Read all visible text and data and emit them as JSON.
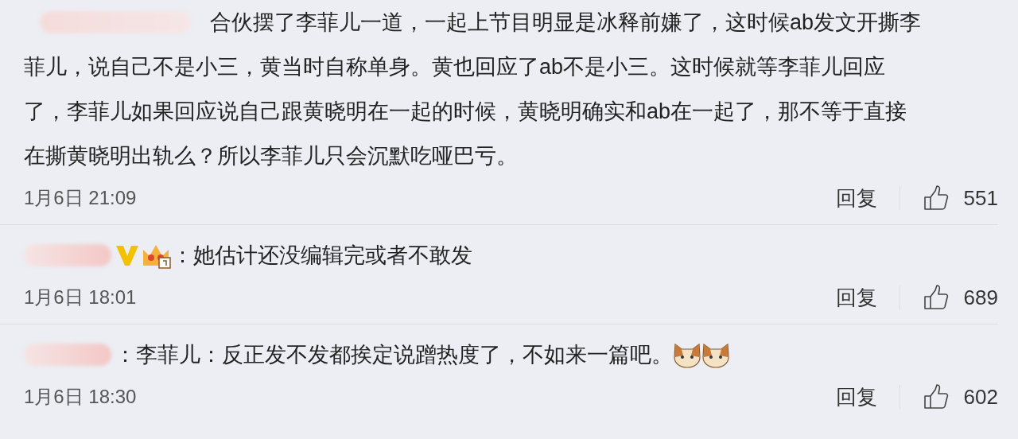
{
  "comments": [
    {
      "lines": [
        "合伙摆了李菲儿一道，一起上节目明显是冰释前嫌了，这时候ab发文开撕李",
        "菲儿，说自己不是小三，黄当时自称单身。黄也回应了ab不是小三。这时候就等李菲儿回应",
        "了，李菲儿如果回应说自己跟黄晓明在一起的时候，黄晓明确实和ab在一起了，那不等于直接",
        "在撕黄晓明出轨么？所以李菲儿只会沉默吃哑巴亏。"
      ],
      "verified": false,
      "stickers": false,
      "time": "1月6日 21:09",
      "reply": "回复",
      "likes": "551"
    },
    {
      "text": "：她估计还没编辑完或者不敢发",
      "verified": true,
      "stickers": false,
      "time": "1月6日 18:01",
      "reply": "回复",
      "likes": "689"
    },
    {
      "text": "：李菲儿：反正发不发都挨定说蹭热度了，不如来一篇吧。",
      "verified": false,
      "stickers": true,
      "time": "1月6日 18:30",
      "reply": "回复",
      "likes": "602"
    }
  ]
}
